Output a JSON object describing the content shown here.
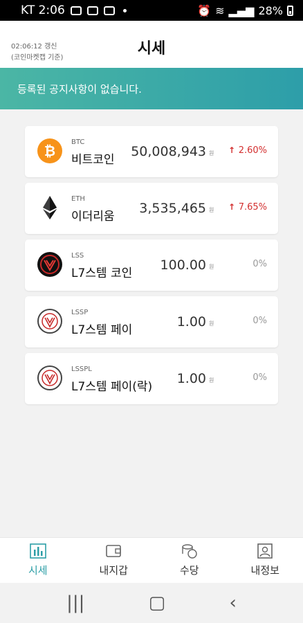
{
  "statusbar": {
    "time": "KT 2:06",
    "battery": "28%"
  },
  "header": {
    "update_time": "02:06:12 갱신",
    "update_source": "(코인마켓캡 기준)",
    "title": "시세"
  },
  "notice": {
    "text": "등록된 공지사항이 없습니다."
  },
  "coins": [
    {
      "symbol": "BTC",
      "name": "비트코인",
      "price": "50,008,943",
      "unit": "원",
      "change": "2.60%",
      "direction": "up",
      "icon": "bitcoin-icon"
    },
    {
      "symbol": "ETH",
      "name": "이더리움",
      "price": "3,535,465",
      "unit": "원",
      "change": "7.65%",
      "direction": "up",
      "icon": "ethereum-icon"
    },
    {
      "symbol": "LSS",
      "name": "L7스템 코인",
      "price": "100.00",
      "unit": "원",
      "change": "0%",
      "direction": "flat",
      "icon": "l7-coin-icon"
    },
    {
      "symbol": "LSSP",
      "name": "L7스템 페이",
      "price": "1.00",
      "unit": "원",
      "change": "0%",
      "direction": "flat",
      "icon": "l7-pay-icon"
    },
    {
      "symbol": "LSSPL",
      "name": "L7스템 페이(락)",
      "price": "1.00",
      "unit": "원",
      "change": "0%",
      "direction": "flat",
      "icon": "l7-pay-lock-icon"
    }
  ],
  "nav": [
    {
      "label": "시세",
      "icon": "chart-icon",
      "active": true
    },
    {
      "label": "내지갑",
      "icon": "wallet-icon",
      "active": false
    },
    {
      "label": "수당",
      "icon": "coin-stack-icon",
      "active": false
    },
    {
      "label": "내정보",
      "icon": "profile-icon",
      "active": false
    }
  ],
  "colors": {
    "accent": "#2c9ea6",
    "up": "#d32f2f",
    "notice_start": "#4bb6a5",
    "notice_end": "#2d9ea9"
  }
}
